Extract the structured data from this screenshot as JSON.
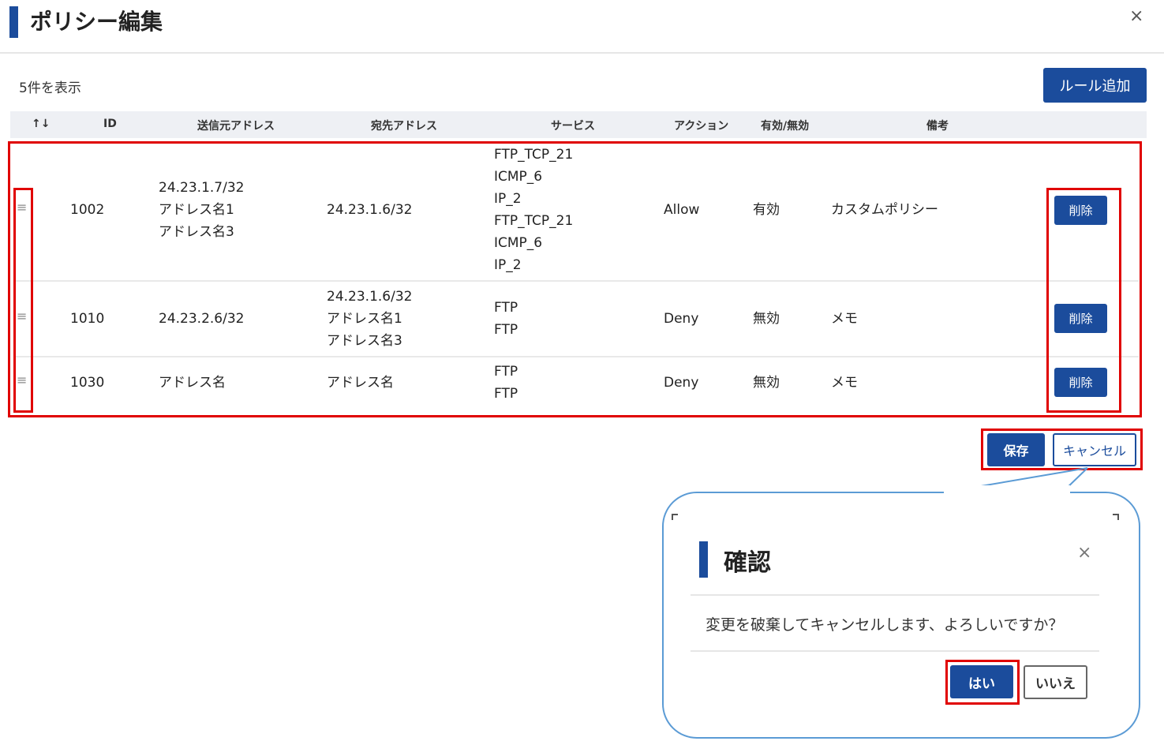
{
  "header": {
    "title": "ポリシー編集",
    "close_glyph": "×"
  },
  "toolbar": {
    "count_text": "5件を表示",
    "add_rule_label": "ルール追加"
  },
  "table": {
    "columns": [
      "↑↓",
      "ID",
      "送信元アドレス",
      "宛先アドレス",
      "サービス",
      "アクション",
      "有効/無効",
      "備考"
    ],
    "rows": [
      {
        "handle": "≡",
        "id": "1002",
        "src": [
          "24.23.1.7/32",
          "アドレス名1",
          "アドレス名3"
        ],
        "dst": [
          "24.23.1.6/32"
        ],
        "svc": [
          "FTP_TCP_21",
          "ICMP_6",
          "IP_2",
          "FTP_TCP_21",
          "ICMP_6",
          "IP_2"
        ],
        "action": "Allow",
        "status": "有効",
        "note": "カスタムポリシー",
        "delete_label": "削除"
      },
      {
        "handle": "≡",
        "id": "1010",
        "src": [
          "24.23.2.6/32"
        ],
        "dst": [
          "24.23.1.6/32",
          "アドレス名1",
          "アドレス名3"
        ],
        "svc": [
          "FTP",
          "FTP"
        ],
        "action": "Deny",
        "status": "無効",
        "note": "メモ",
        "delete_label": "削除"
      },
      {
        "handle": "≡",
        "id": "1030",
        "src": [
          "アドレス名"
        ],
        "dst": [
          "アドレス名"
        ],
        "svc": [
          "FTP",
          "FTP"
        ],
        "action": "Deny",
        "status": "無効",
        "note": "メモ",
        "delete_label": "削除"
      }
    ]
  },
  "actions": {
    "save_label": "保存",
    "cancel_label": "キャンセル"
  },
  "dialog": {
    "title": "確認",
    "close_glyph": "×",
    "message": "変更を破棄してキャンセルします、よろしいですか？",
    "yes_label": "はい",
    "no_label": "いいえ"
  },
  "colors": {
    "primary": "#1b4c9c",
    "highlight": "#e00000",
    "callout_border": "#5b9bd5"
  }
}
